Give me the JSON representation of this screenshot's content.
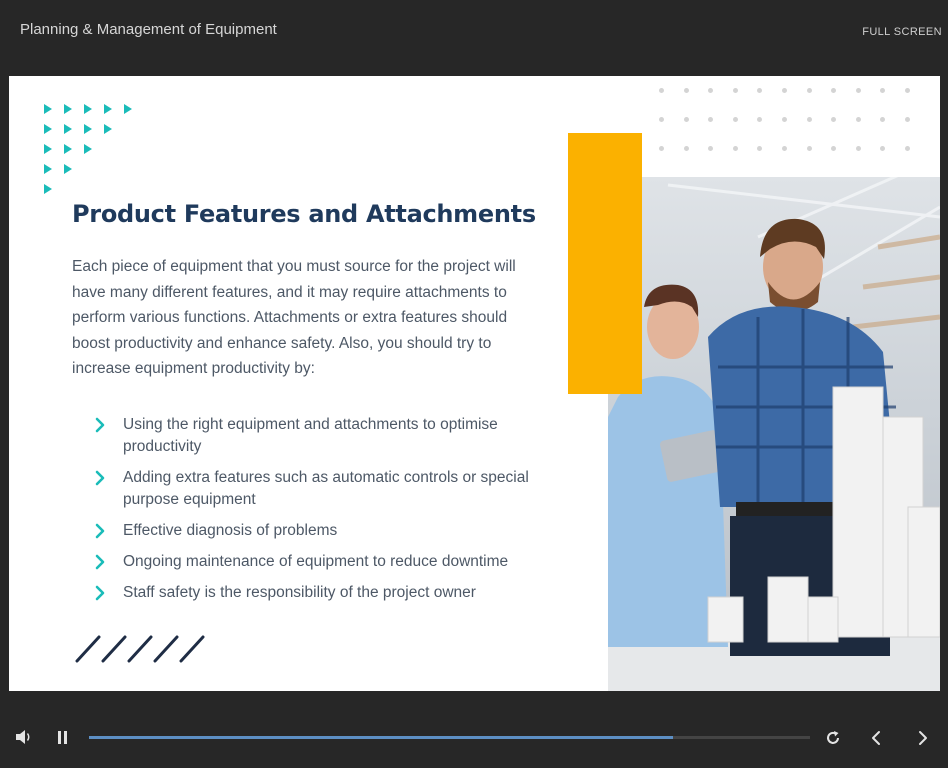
{
  "header": {
    "course_title": "Planning & Management of Equipment",
    "fullscreen_label": "FULL SCREEN"
  },
  "slide": {
    "title": "Product Features and Attachments",
    "intro": "Each piece of equipment that you must source for the project will have many different features, and it may require attachments to perform various functions. Attachments or extra features should boost productivity and enhance safety. Also, you should try to increase equipment productivity by:",
    "bullets": [
      "Using the right equipment and attachments to optimise productivity",
      "Adding extra features such as automatic controls or special purpose equipment",
      "Effective diagnosis of problems",
      "Ongoing maintenance of equipment to reduce downtime",
      "Staff safety is the responsibility of the project owner"
    ]
  },
  "colors": {
    "accent_teal": "#1abcb9",
    "accent_yellow": "#fbb100",
    "title_navy": "#1f3a5c",
    "progress_blue": "#5d8fc4"
  },
  "player": {
    "progress_fraction": 0.81,
    "icons": [
      "volume-icon",
      "pause-icon",
      "replay-icon",
      "previous-icon",
      "next-icon"
    ]
  }
}
